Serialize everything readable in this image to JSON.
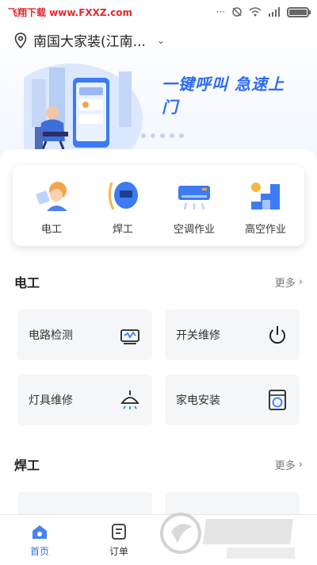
{
  "status_bar": {
    "watermark": "飞翔下载 www.FXXZ.com"
  },
  "header": {
    "location": "南国大家装(江南...",
    "location_icon": "location-pin-icon",
    "banner_slogan": "一键呼叫 急速上门",
    "banner_dots": 5
  },
  "categories": [
    {
      "label": "电工",
      "icon": "electrician-icon"
    },
    {
      "label": "焊工",
      "icon": "welder-icon"
    },
    {
      "label": "空调作业",
      "icon": "air-conditioner-icon"
    },
    {
      "label": "高空作业",
      "icon": "high-altitude-icon"
    }
  ],
  "sections": [
    {
      "title": "电工",
      "more": "更多",
      "items": [
        {
          "label": "电路检测",
          "icon": "circuit-test-icon"
        },
        {
          "label": "开关维修",
          "icon": "power-switch-icon"
        },
        {
          "label": "灯具维修",
          "icon": "lamp-icon"
        },
        {
          "label": "家电安装",
          "icon": "washing-machine-icon"
        }
      ]
    },
    {
      "title": "焊工",
      "more": "更多"
    }
  ],
  "tabbar": {
    "tabs": [
      {
        "label": "首页",
        "icon": "home-icon",
        "active": true
      },
      {
        "label": "订单",
        "icon": "order-icon",
        "active": false
      }
    ]
  },
  "colors": {
    "accent": "#2e6cf0",
    "watermark_red": "#e8262a"
  }
}
